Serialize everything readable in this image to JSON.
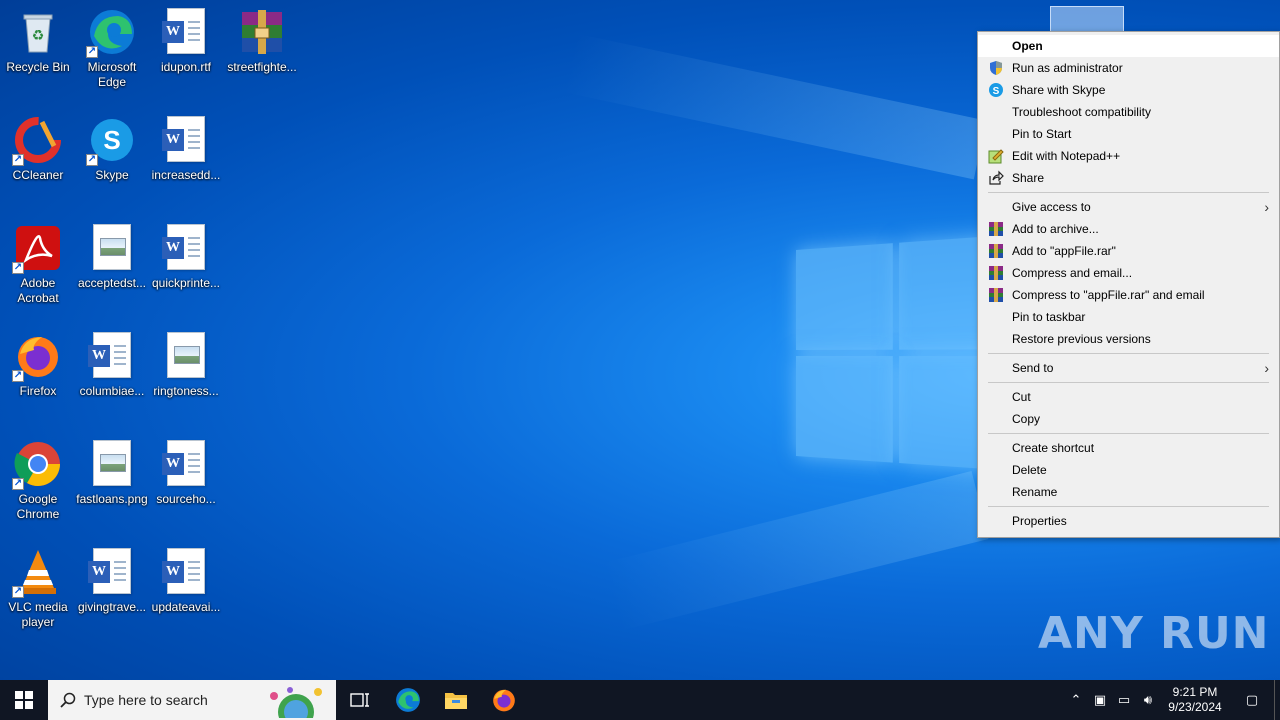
{
  "desktop": {
    "icons": [
      {
        "label": "Recycle Bin",
        "icon": "recycle-bin-icon"
      },
      {
        "label": "Microsoft Edge",
        "icon": "edge-icon"
      },
      {
        "label": "idupon.rtf",
        "icon": "word-doc-icon"
      },
      {
        "label": "streetfighte...",
        "icon": "winrar-icon"
      },
      {
        "label": "CCleaner",
        "icon": "ccleaner-icon"
      },
      {
        "label": "Skype",
        "icon": "skype-icon"
      },
      {
        "label": "increasedd...",
        "icon": "word-doc-icon"
      },
      {
        "label": "Adobe Acrobat",
        "icon": "acrobat-icon"
      },
      {
        "label": "acceptedst...",
        "icon": "image-file-icon"
      },
      {
        "label": "quickprinte...",
        "icon": "word-doc-icon"
      },
      {
        "label": "Firefox",
        "icon": "firefox-icon"
      },
      {
        "label": "columbiae...",
        "icon": "word-doc-icon"
      },
      {
        "label": "ringtoness...",
        "icon": "image-file-icon"
      },
      {
        "label": "Google Chrome",
        "icon": "chrome-icon"
      },
      {
        "label": "fastloans.png",
        "icon": "image-file-icon"
      },
      {
        "label": "sourceho...",
        "icon": "word-doc-icon"
      },
      {
        "label": "VLC media player",
        "icon": "vlc-icon"
      },
      {
        "label": "givingtrave...",
        "icon": "word-doc-icon"
      },
      {
        "label": "updateavai...",
        "icon": "word-doc-icon"
      }
    ]
  },
  "context_menu": {
    "items": [
      {
        "label": "Open"
      },
      {
        "label": "Run as administrator",
        "icon": "shield-icon"
      },
      {
        "label": "Share with Skype",
        "icon": "skype-icon"
      },
      {
        "label": "Troubleshoot compatibility"
      },
      {
        "label": "Pin to Start"
      },
      {
        "label": "Edit with Notepad++",
        "icon": "notepadpp-icon"
      },
      {
        "label": "Share",
        "icon": "share-icon"
      },
      {
        "label": "Give access to"
      },
      {
        "label": "Add to archive...",
        "icon": "winrar-icon"
      },
      {
        "label": "Add to \"appFile.rar\"",
        "icon": "winrar-icon"
      },
      {
        "label": "Compress and email...",
        "icon": "winrar-icon"
      },
      {
        "label": "Compress to \"appFile.rar\" and email",
        "icon": "winrar-icon"
      },
      {
        "label": "Pin to taskbar"
      },
      {
        "label": "Restore previous versions"
      },
      {
        "label": "Send to"
      },
      {
        "label": "Cut"
      },
      {
        "label": "Copy"
      },
      {
        "label": "Create shortcut"
      },
      {
        "label": "Delete"
      },
      {
        "label": "Rename"
      },
      {
        "label": "Properties"
      }
    ]
  },
  "taskbar": {
    "search_placeholder": "Type here to search",
    "apps": [
      "task-view-icon",
      "edge-icon",
      "file-explorer-icon",
      "firefox-icon"
    ],
    "clock_time": "9:21 PM",
    "clock_date": "9/23/2024"
  },
  "watermark": "ANY RUN",
  "colors": {
    "taskbar_bg": "#101623",
    "menu_bg": "#f0f0f0",
    "wallpaper_accent": "#1a8af0"
  }
}
